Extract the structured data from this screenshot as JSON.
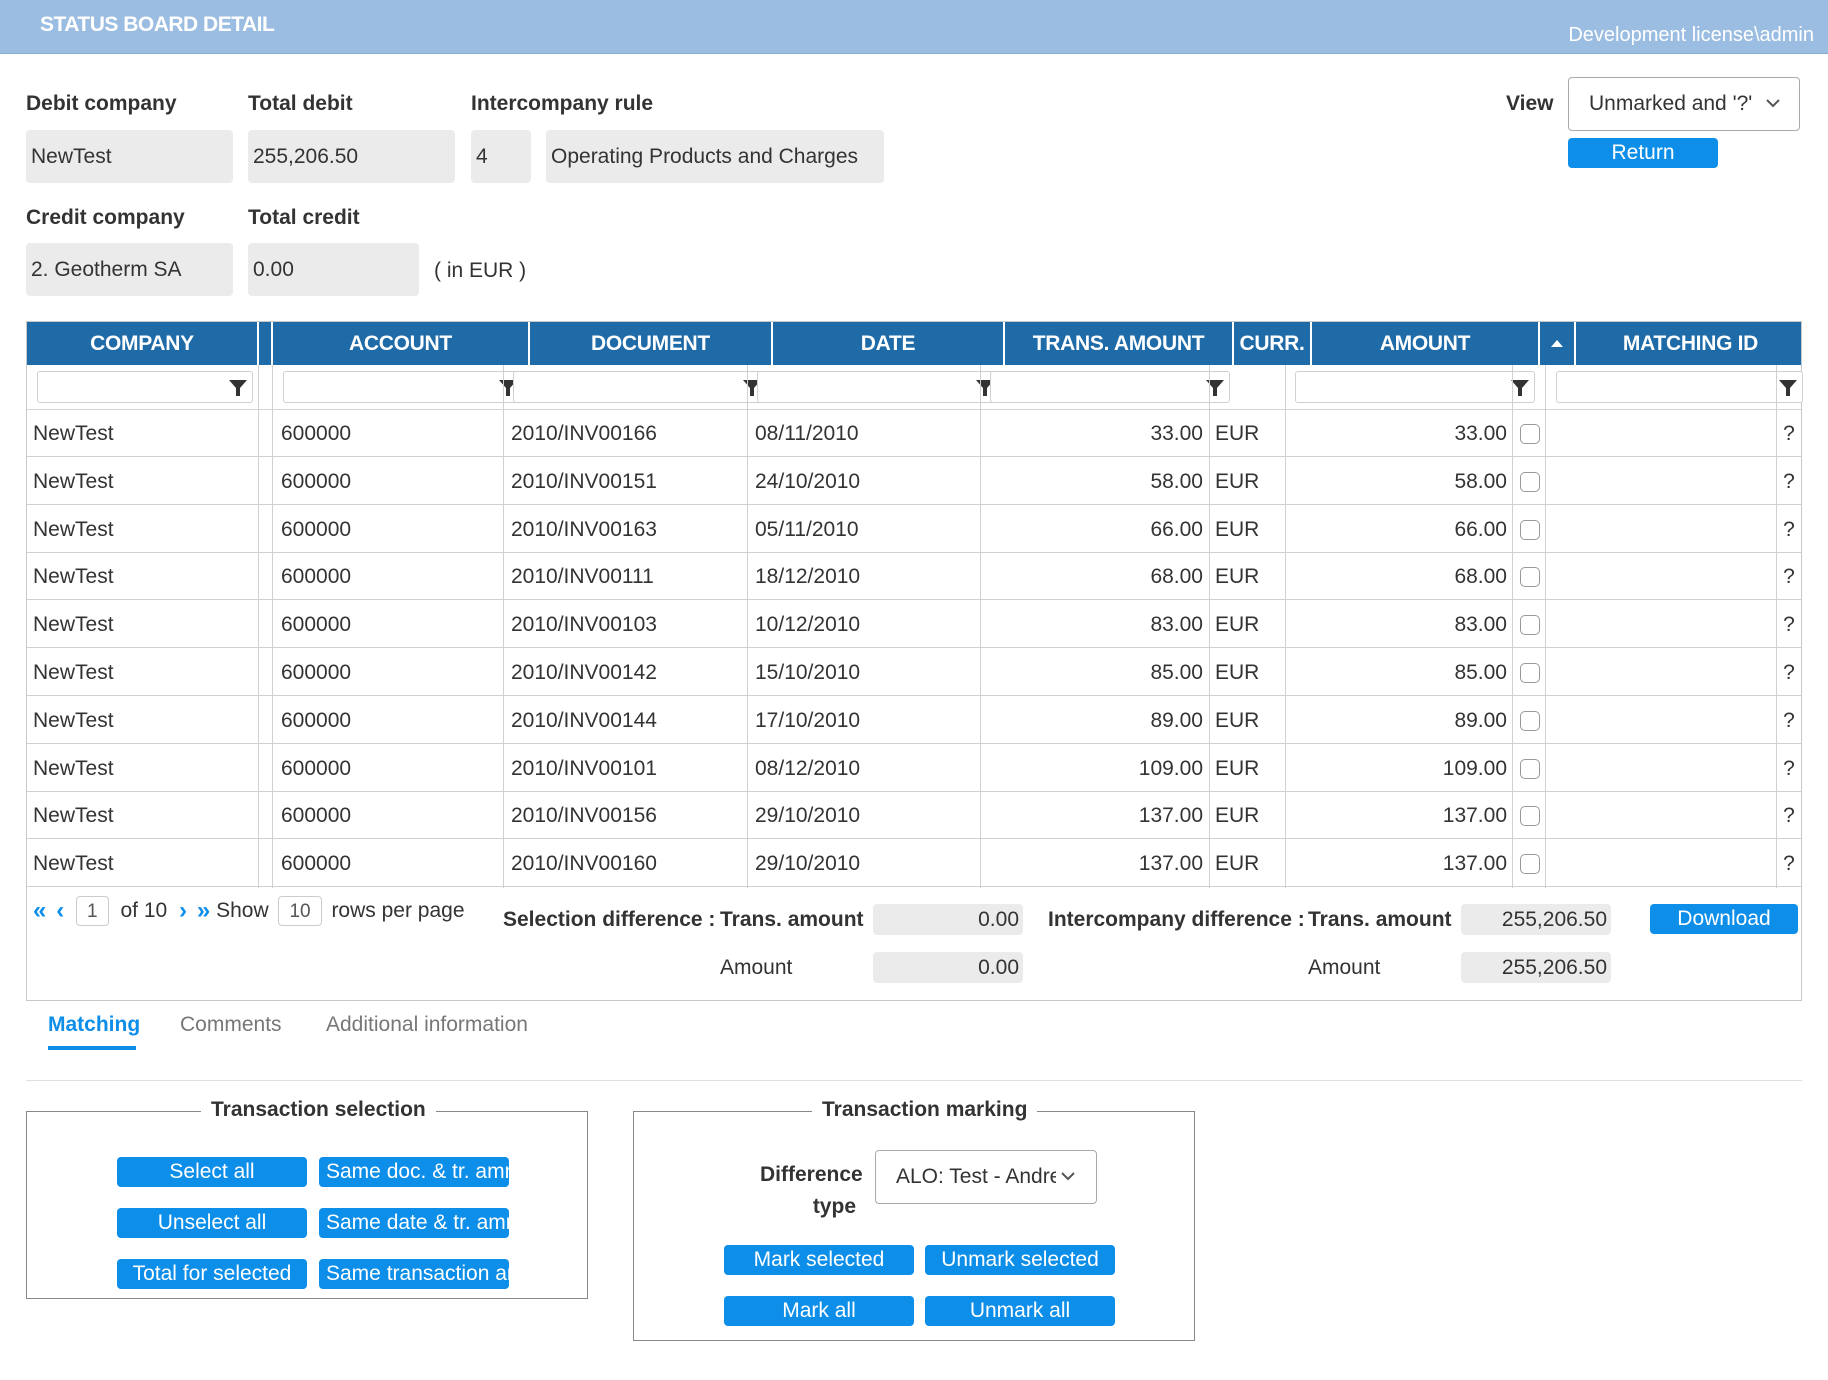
{
  "header": {
    "title": "STATUS BOARD DETAIL",
    "license": "Development license\\admin"
  },
  "form": {
    "debit_company_label": "Debit company",
    "debit_company_value": "NewTest",
    "total_debit_label": "Total debit",
    "total_debit_value": "255,206.50",
    "intercompany_rule_label": "Intercompany rule",
    "intercompany_rule_code": "4",
    "intercompany_rule_name": "Operating Products and Charges",
    "credit_company_label": "Credit company",
    "credit_company_value": "2. Geotherm SA",
    "total_credit_label": "Total credit",
    "total_credit_value": "0.00",
    "currency_note": "( in EUR )",
    "view_label": "View",
    "view_value": "Unmarked and '?'",
    "return_button": "Return"
  },
  "grid": {
    "columns": [
      "COMPANY",
      "ACCOUNT",
      "DOCUMENT",
      "DATE",
      "TRANS. AMOUNT",
      "CURR.",
      "AMOUNT",
      "MATCHING ID"
    ],
    "rows": [
      {
        "company": "NewTest",
        "account": "600000",
        "document": "2010/INV00166",
        "date": "08/11/2010",
        "trans_amount": "33.00",
        "curr": "EUR",
        "amount": "33.00",
        "matching_id": "",
        "flag": "?"
      },
      {
        "company": "NewTest",
        "account": "600000",
        "document": "2010/INV00151",
        "date": "24/10/2010",
        "trans_amount": "58.00",
        "curr": "EUR",
        "amount": "58.00",
        "matching_id": "",
        "flag": "?"
      },
      {
        "company": "NewTest",
        "account": "600000",
        "document": "2010/INV00163",
        "date": "05/11/2010",
        "trans_amount": "66.00",
        "curr": "EUR",
        "amount": "66.00",
        "matching_id": "",
        "flag": "?"
      },
      {
        "company": "NewTest",
        "account": "600000",
        "document": "2010/INV00111",
        "date": "18/12/2010",
        "trans_amount": "68.00",
        "curr": "EUR",
        "amount": "68.00",
        "matching_id": "",
        "flag": "?"
      },
      {
        "company": "NewTest",
        "account": "600000",
        "document": "2010/INV00103",
        "date": "10/12/2010",
        "trans_amount": "83.00",
        "curr": "EUR",
        "amount": "83.00",
        "matching_id": "",
        "flag": "?"
      },
      {
        "company": "NewTest",
        "account": "600000",
        "document": "2010/INV00142",
        "date": "15/10/2010",
        "trans_amount": "85.00",
        "curr": "EUR",
        "amount": "85.00",
        "matching_id": "",
        "flag": "?"
      },
      {
        "company": "NewTest",
        "account": "600000",
        "document": "2010/INV00144",
        "date": "17/10/2010",
        "trans_amount": "89.00",
        "curr": "EUR",
        "amount": "89.00",
        "matching_id": "",
        "flag": "?"
      },
      {
        "company": "NewTest",
        "account": "600000",
        "document": "2010/INV00101",
        "date": "08/12/2010",
        "trans_amount": "109.00",
        "curr": "EUR",
        "amount": "109.00",
        "matching_id": "",
        "flag": "?"
      },
      {
        "company": "NewTest",
        "account": "600000",
        "document": "2010/INV00156",
        "date": "29/10/2010",
        "trans_amount": "137.00",
        "curr": "EUR",
        "amount": "137.00",
        "matching_id": "",
        "flag": "?"
      },
      {
        "company": "NewTest",
        "account": "600000",
        "document": "2010/INV00160",
        "date": "29/10/2010",
        "trans_amount": "137.00",
        "curr": "EUR",
        "amount": "137.00",
        "matching_id": "",
        "flag": "?"
      }
    ]
  },
  "pager": {
    "current_page": "1",
    "of_label": "of",
    "total_pages": "10",
    "show_label": "Show",
    "rows_per_page": "10",
    "rows_per_page_label": "rows per page"
  },
  "summary": {
    "selection_difference_label": "Selection difference :",
    "intercompany_difference_label": "Intercompany difference :",
    "trans_amount_label": "Trans. amount",
    "amount_label": "Amount",
    "sel_trans_amount": "0.00",
    "sel_amount": "0.00",
    "ic_trans_amount": "255,206.50",
    "ic_amount": "255,206.50",
    "download_button": "Download"
  },
  "tabs": [
    {
      "label": "Matching",
      "active": true
    },
    {
      "label": "Comments",
      "active": false
    },
    {
      "label": "Additional information",
      "active": false
    }
  ],
  "transaction_selection": {
    "legend": "Transaction selection",
    "buttons": [
      "Select all",
      "Same doc. & tr. amnt",
      "Unselect all",
      "Same date & tr. amnt",
      "Total for selected",
      "Same transaction amount"
    ]
  },
  "transaction_marking": {
    "legend": "Transaction marking",
    "difference_type_label_1": "Difference",
    "difference_type_label_2": "type",
    "difference_type_value": "ALO: Test - Andre",
    "buttons": [
      "Mark selected",
      "Unmark selected",
      "Mark all",
      "Unmark all"
    ]
  },
  "colors": {
    "header_bar": "#9bbde1",
    "grid_header": "#1f6ba8",
    "accent": "#0d8ee9"
  }
}
